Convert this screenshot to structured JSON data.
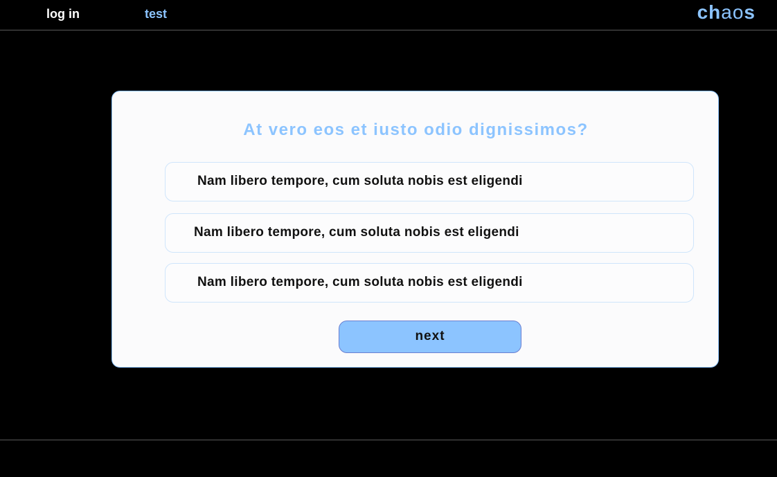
{
  "nav": {
    "login_label": "log in",
    "test_label": "test",
    "logo": {
      "part1": "ch",
      "part2": "ao",
      "part3": "s"
    }
  },
  "quiz": {
    "question": "At vero eos et iusto odio dignissimos?",
    "options": [
      {
        "label": "Nam libero tempore, cum soluta nobis est eligendi"
      },
      {
        "label": "Nam libero tempore, cum soluta nobis est eligendi"
      },
      {
        "label": "Nam libero tempore, cum soluta nobis est eligendi"
      }
    ],
    "next_label": "next"
  },
  "colors": {
    "accent": "#8cc4ff",
    "background": "#000000",
    "card": "#fbfbfc"
  }
}
